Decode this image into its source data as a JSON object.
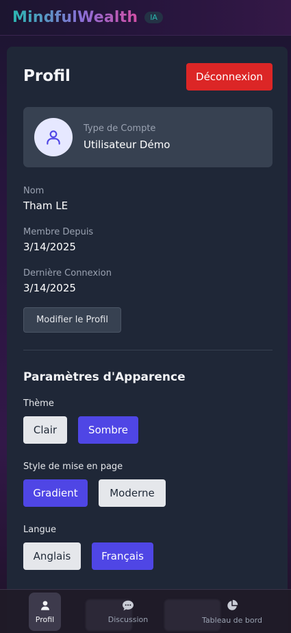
{
  "header": {
    "brand": "MindfulWealth",
    "badge": "IA"
  },
  "profile": {
    "title": "Profil",
    "logout_label": "Déconnexion",
    "account_type_label": "Type de Compte",
    "account_type_value": "Utilisateur Démo",
    "fields": [
      {
        "label": "Nom",
        "value": "Tham LE"
      },
      {
        "label": "Membre Depuis",
        "value": "3/14/2025"
      },
      {
        "label": "Dernière Connexion",
        "value": "3/14/2025"
      }
    ],
    "edit_label": "Modifier le Profil"
  },
  "appearance": {
    "title": "Paramètres d'Apparence",
    "theme": {
      "label": "Thème",
      "options": [
        "Clair",
        "Sombre"
      ],
      "selected": "Sombre"
    },
    "layout": {
      "label": "Style de mise en page",
      "options": [
        "Gradient",
        "Moderne"
      ],
      "selected": "Gradient"
    },
    "language": {
      "label": "Langue",
      "options": [
        "Anglais",
        "Français"
      ],
      "selected": "Français"
    }
  },
  "nav": {
    "items": [
      {
        "label": "Profil",
        "icon": "user-icon",
        "active": true
      },
      {
        "label": "Discussion",
        "icon": "chat-icon",
        "active": false
      },
      {
        "label": "Tableau de bord",
        "icon": "pie-chart-icon",
        "active": false
      }
    ]
  },
  "colors": {
    "accent": "#4f46e5",
    "danger": "#dc2626",
    "card": "#1f2737",
    "brand_gradient": [
      "#2bb7b0",
      "#8a6fd6",
      "#d24fa5"
    ]
  }
}
